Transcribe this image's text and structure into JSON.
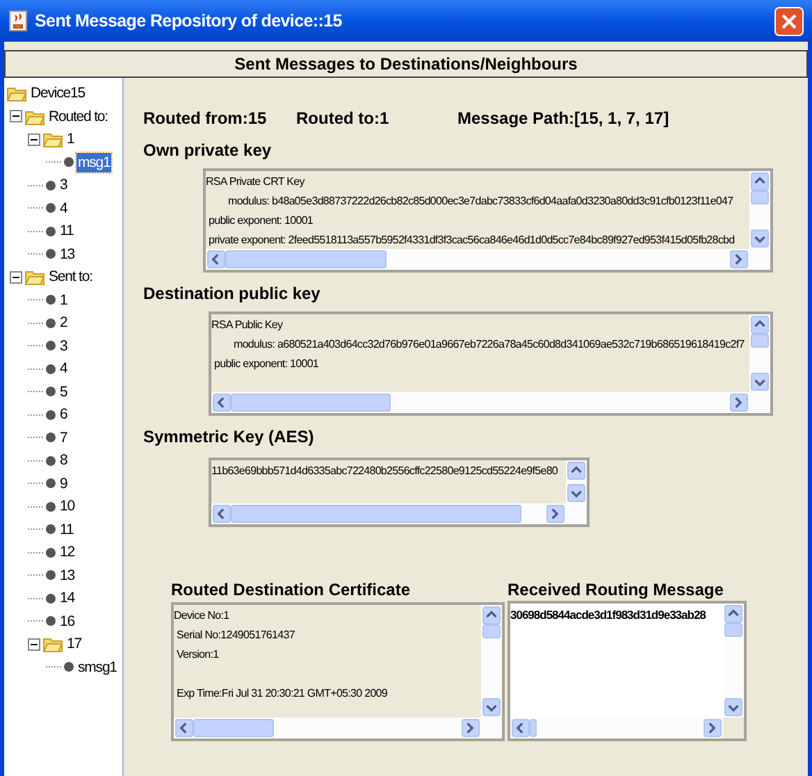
{
  "window": {
    "title": "Sent Message Repository of device::15"
  },
  "header": "Sent Messages to Destinations/Neighbours",
  "tree": [
    {
      "label": "Device15",
      "kind": "folder",
      "expanded": true,
      "selected": false,
      "children": [
        {
          "label": "Routed to:",
          "kind": "folder",
          "expanded": true,
          "selected": false,
          "children": [
            {
              "label": "1",
              "kind": "folder",
              "expanded": true,
              "selected": false,
              "children": [
                {
                  "label": "msg1",
                  "kind": "leaf",
                  "selected": true
                }
              ]
            },
            {
              "label": "3",
              "kind": "leaf",
              "selected": false
            },
            {
              "label": "4",
              "kind": "leaf",
              "selected": false
            },
            {
              "label": "11",
              "kind": "leaf",
              "selected": false
            },
            {
              "label": "13",
              "kind": "leaf",
              "selected": false
            }
          ]
        },
        {
          "label": "Sent to:",
          "kind": "folder",
          "expanded": true,
          "selected": false,
          "children": [
            {
              "label": "1",
              "kind": "leaf",
              "selected": false
            },
            {
              "label": "2",
              "kind": "leaf",
              "selected": false
            },
            {
              "label": "3",
              "kind": "leaf",
              "selected": false
            },
            {
              "label": "4",
              "kind": "leaf",
              "selected": false
            },
            {
              "label": "5",
              "kind": "leaf",
              "selected": false
            },
            {
              "label": "6",
              "kind": "leaf",
              "selected": false
            },
            {
              "label": "7",
              "kind": "leaf",
              "selected": false
            },
            {
              "label": "8",
              "kind": "leaf",
              "selected": false
            },
            {
              "label": "9",
              "kind": "leaf",
              "selected": false
            },
            {
              "label": "10",
              "kind": "leaf",
              "selected": false
            },
            {
              "label": "11",
              "kind": "leaf",
              "selected": false
            },
            {
              "label": "12",
              "kind": "leaf",
              "selected": false
            },
            {
              "label": "13",
              "kind": "leaf",
              "selected": false
            },
            {
              "label": "14",
              "kind": "leaf",
              "selected": false
            },
            {
              "label": "16",
              "kind": "leaf",
              "selected": false
            },
            {
              "label": "17",
              "kind": "folder",
              "expanded": true,
              "selected": false,
              "children": [
                {
                  "label": "smsg1",
                  "kind": "leaf",
                  "selected": false
                }
              ]
            }
          ]
        }
      ]
    }
  ],
  "route": {
    "from": "Routed from:15",
    "to": "Routed to:1",
    "path": "Message Path:[15, 1, 7, 17]"
  },
  "private_key": {
    "label": "Own private key",
    "lines": [
      "RSA Private CRT Key",
      "modulus: b48a05e3d88737222d26cb82c85d000ec3e7dabc73833cf6d04aafa0d3230a80dd3c91cfb0123f11e047",
      "public exponent: 10001",
      "private exponent: 2feed5518113a557b5952f4331df3f3cac56ca846e46d1d0d5cc7e84bc89f927ed953f415d05fb28cbd"
    ]
  },
  "public_key": {
    "label": "Destination public key",
    "lines": [
      "RSA Public Key",
      "modulus: a680521a403d64cc32d76b976e01a9667eb7226a78a45c60d8d341069ae532c719b686519618419c2f7",
      "public exponent: 10001"
    ]
  },
  "symmetric_key": {
    "label": "Symmetric Key (AES)",
    "lines": [
      "11b63e69bbb571d4d6335abc722480b2556cffc22580e9125cd55224e9f5e80"
    ]
  },
  "certificate": {
    "label": "Routed Destination Certificate",
    "lines": [
      "Device No:1",
      "Serial No:1249051761437",
      "Version:1",
      {
        "text": "Exp Time:Fri Jul 31 20:30:21 GMT+05:30 2009",
        "space_before": true
      }
    ]
  },
  "routing_message": {
    "label": "Received Routing Message",
    "lines": [
      "30698d5844acde3d1f983d31d9e33ab28"
    ]
  }
}
